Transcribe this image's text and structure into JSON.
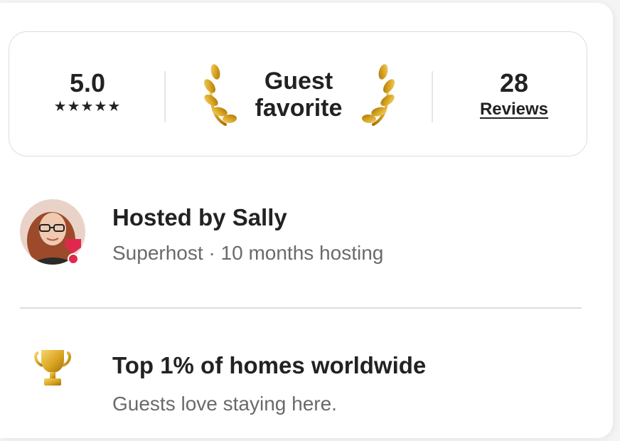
{
  "rating": {
    "score": "5.0",
    "stars": "★★★★★",
    "badge_line1": "Guest",
    "badge_line2": "favorite",
    "reviews_count": "28",
    "reviews_label": "Reviews"
  },
  "host": {
    "title": "Hosted by Sally",
    "subtitle": "Superhost · 10 months hosting"
  },
  "highlight": {
    "title": "Top 1% of homes worldwide",
    "subtitle": "Guests love staying here."
  },
  "colors": {
    "text_primary": "#222222",
    "text_secondary": "#6a6a6a",
    "superhost_badge": "#e0284f",
    "gold": "#d9a521",
    "border": "#dddddd"
  },
  "icons": {
    "laurel": "laurel-icon",
    "trophy": "trophy-icon",
    "superhost": "superhost-badge-icon",
    "star": "star-icon"
  }
}
